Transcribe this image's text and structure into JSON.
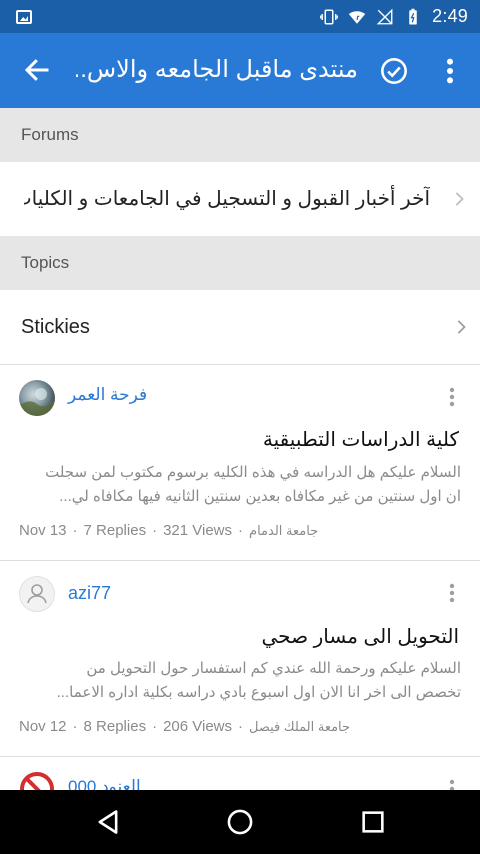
{
  "status_bar": {
    "time": "2:49",
    "icons": [
      "image-icon",
      "vibrate-icon",
      "wifi-icon",
      "no-signal-icon",
      "battery-icon"
    ]
  },
  "app_bar": {
    "title": "منتدى ماقبل الجامعه والاس...",
    "back_icon": "arrow-back-icon",
    "check_icon": "check-circle-icon",
    "menu_icon": "more-vert-icon",
    "color": "#2979d6"
  },
  "forums_section": {
    "header": "Forums",
    "items": [
      {
        "label": "آخر أخبار القبول و التسجيل في الجامعات و الكليات..."
      }
    ]
  },
  "topics_section": {
    "header": "Topics",
    "stickies_label": "Stickies"
  },
  "topics": [
    {
      "author": "فرحة العمر",
      "title": "كلية الدراسات التطبيقية",
      "excerpt_line1": "السلام عليكم هل الدراسه في هذه الكليه برسوم مكتوب لمن سجلت",
      "excerpt_line2": "ان اول سنتين من غير مكافاه بعدين سنتين الثانيه فيها مكافاه لي...",
      "date": "Nov 13",
      "replies": "7 Replies",
      "views": "321 Views",
      "forum": "جامعة الدمام"
    },
    {
      "author": "azi77",
      "title": "التحويل الى مسار صحي",
      "excerpt_line1": "السلام عليكم ورحمة الله عندي كم استفسار حول التحويل من",
      "excerpt_line2": "تخصص الى اخر انا الان اول اسبوع بادي دراسه بكلية اداره الاعما...",
      "date": "Nov 12",
      "replies": "8 Replies",
      "views": "206 Views",
      "forum": "جامعة الملك فيصل"
    },
    {
      "author": "العنود 000",
      "title": "",
      "excerpt_line1": "",
      "excerpt_line2": "",
      "date": "",
      "replies": "",
      "views": "",
      "forum": ""
    }
  ],
  "nav_bar": {
    "icons": [
      "back-triangle-icon",
      "home-circle-icon",
      "recents-square-icon"
    ]
  }
}
